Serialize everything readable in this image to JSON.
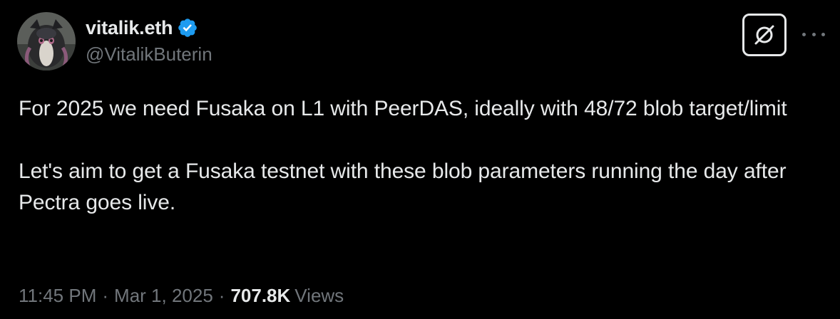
{
  "author": {
    "display_name": "vitalik.eth",
    "handle": "@VitalikButerin",
    "verified": true,
    "verified_badge_color": "#1d9bf0"
  },
  "actions": {
    "grok_icon": "grok-icon",
    "more_icon": "more-options-icon"
  },
  "tweet": {
    "paragraphs": [
      "For 2025 we need Fusaka on L1 with PeerDAS, ideally with 48/72 blob target/limit",
      "Let's aim to get a Fusaka testnet with these blob parameters running the day after Pectra goes live."
    ]
  },
  "meta": {
    "time": "11:45 PM",
    "separator": "·",
    "date": "Mar 1, 2025",
    "views_count": "707.8K",
    "views_label": "Views"
  },
  "colors": {
    "background": "#000000",
    "text_primary": "#e7e9ea",
    "text_secondary": "#71767b"
  }
}
